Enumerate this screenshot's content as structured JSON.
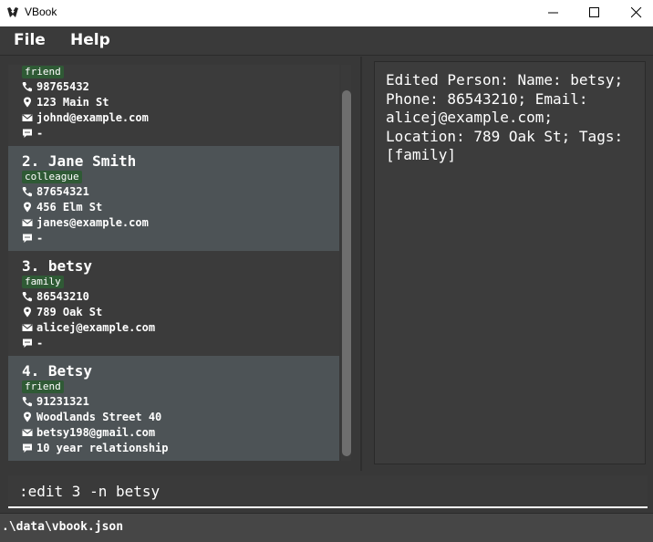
{
  "window": {
    "title": "VBook",
    "icons": [
      "app-logo-icon",
      "minimize-icon",
      "maximize-icon",
      "close-icon"
    ]
  },
  "menu": {
    "file": "File",
    "help": "Help"
  },
  "persons": [
    {
      "name": "",
      "tag": "friend",
      "phone": "98765432",
      "location": "123 Main St",
      "email": "johnd@example.com",
      "remark": "-"
    },
    {
      "name": "2. Jane Smith",
      "tag": "colleague",
      "phone": "87654321",
      "location": "456 Elm St",
      "email": "janes@example.com",
      "remark": "-"
    },
    {
      "name": "3. betsy",
      "tag": "family",
      "phone": "86543210",
      "location": "789 Oak St",
      "email": "alicej@example.com",
      "remark": "-"
    },
    {
      "name": "4. Betsy",
      "tag": "friend",
      "phone": "91231321",
      "location": "Woodlands Street 40",
      "email": "betsy198@gmail.com",
      "remark": "10 year relationship"
    }
  ],
  "field_icons": [
    "phone-icon",
    "location-pin-icon",
    "email-icon",
    "remark-bubble-icon"
  ],
  "result": {
    "text": "Edited Person: Name: betsy;\nPhone: 86543210; Email:\nalicej@example.com;\nLocation: 789 Oak St; Tags:\n[family]"
  },
  "command": {
    "value": ":edit 3 -n betsy"
  },
  "status": {
    "path": ".\\data\\vbook.json"
  },
  "colors": {
    "card_alt": "#4d5356",
    "card_base": "#3b3b3b",
    "tag_bg": "#2f5a35",
    "background": "#383838"
  }
}
